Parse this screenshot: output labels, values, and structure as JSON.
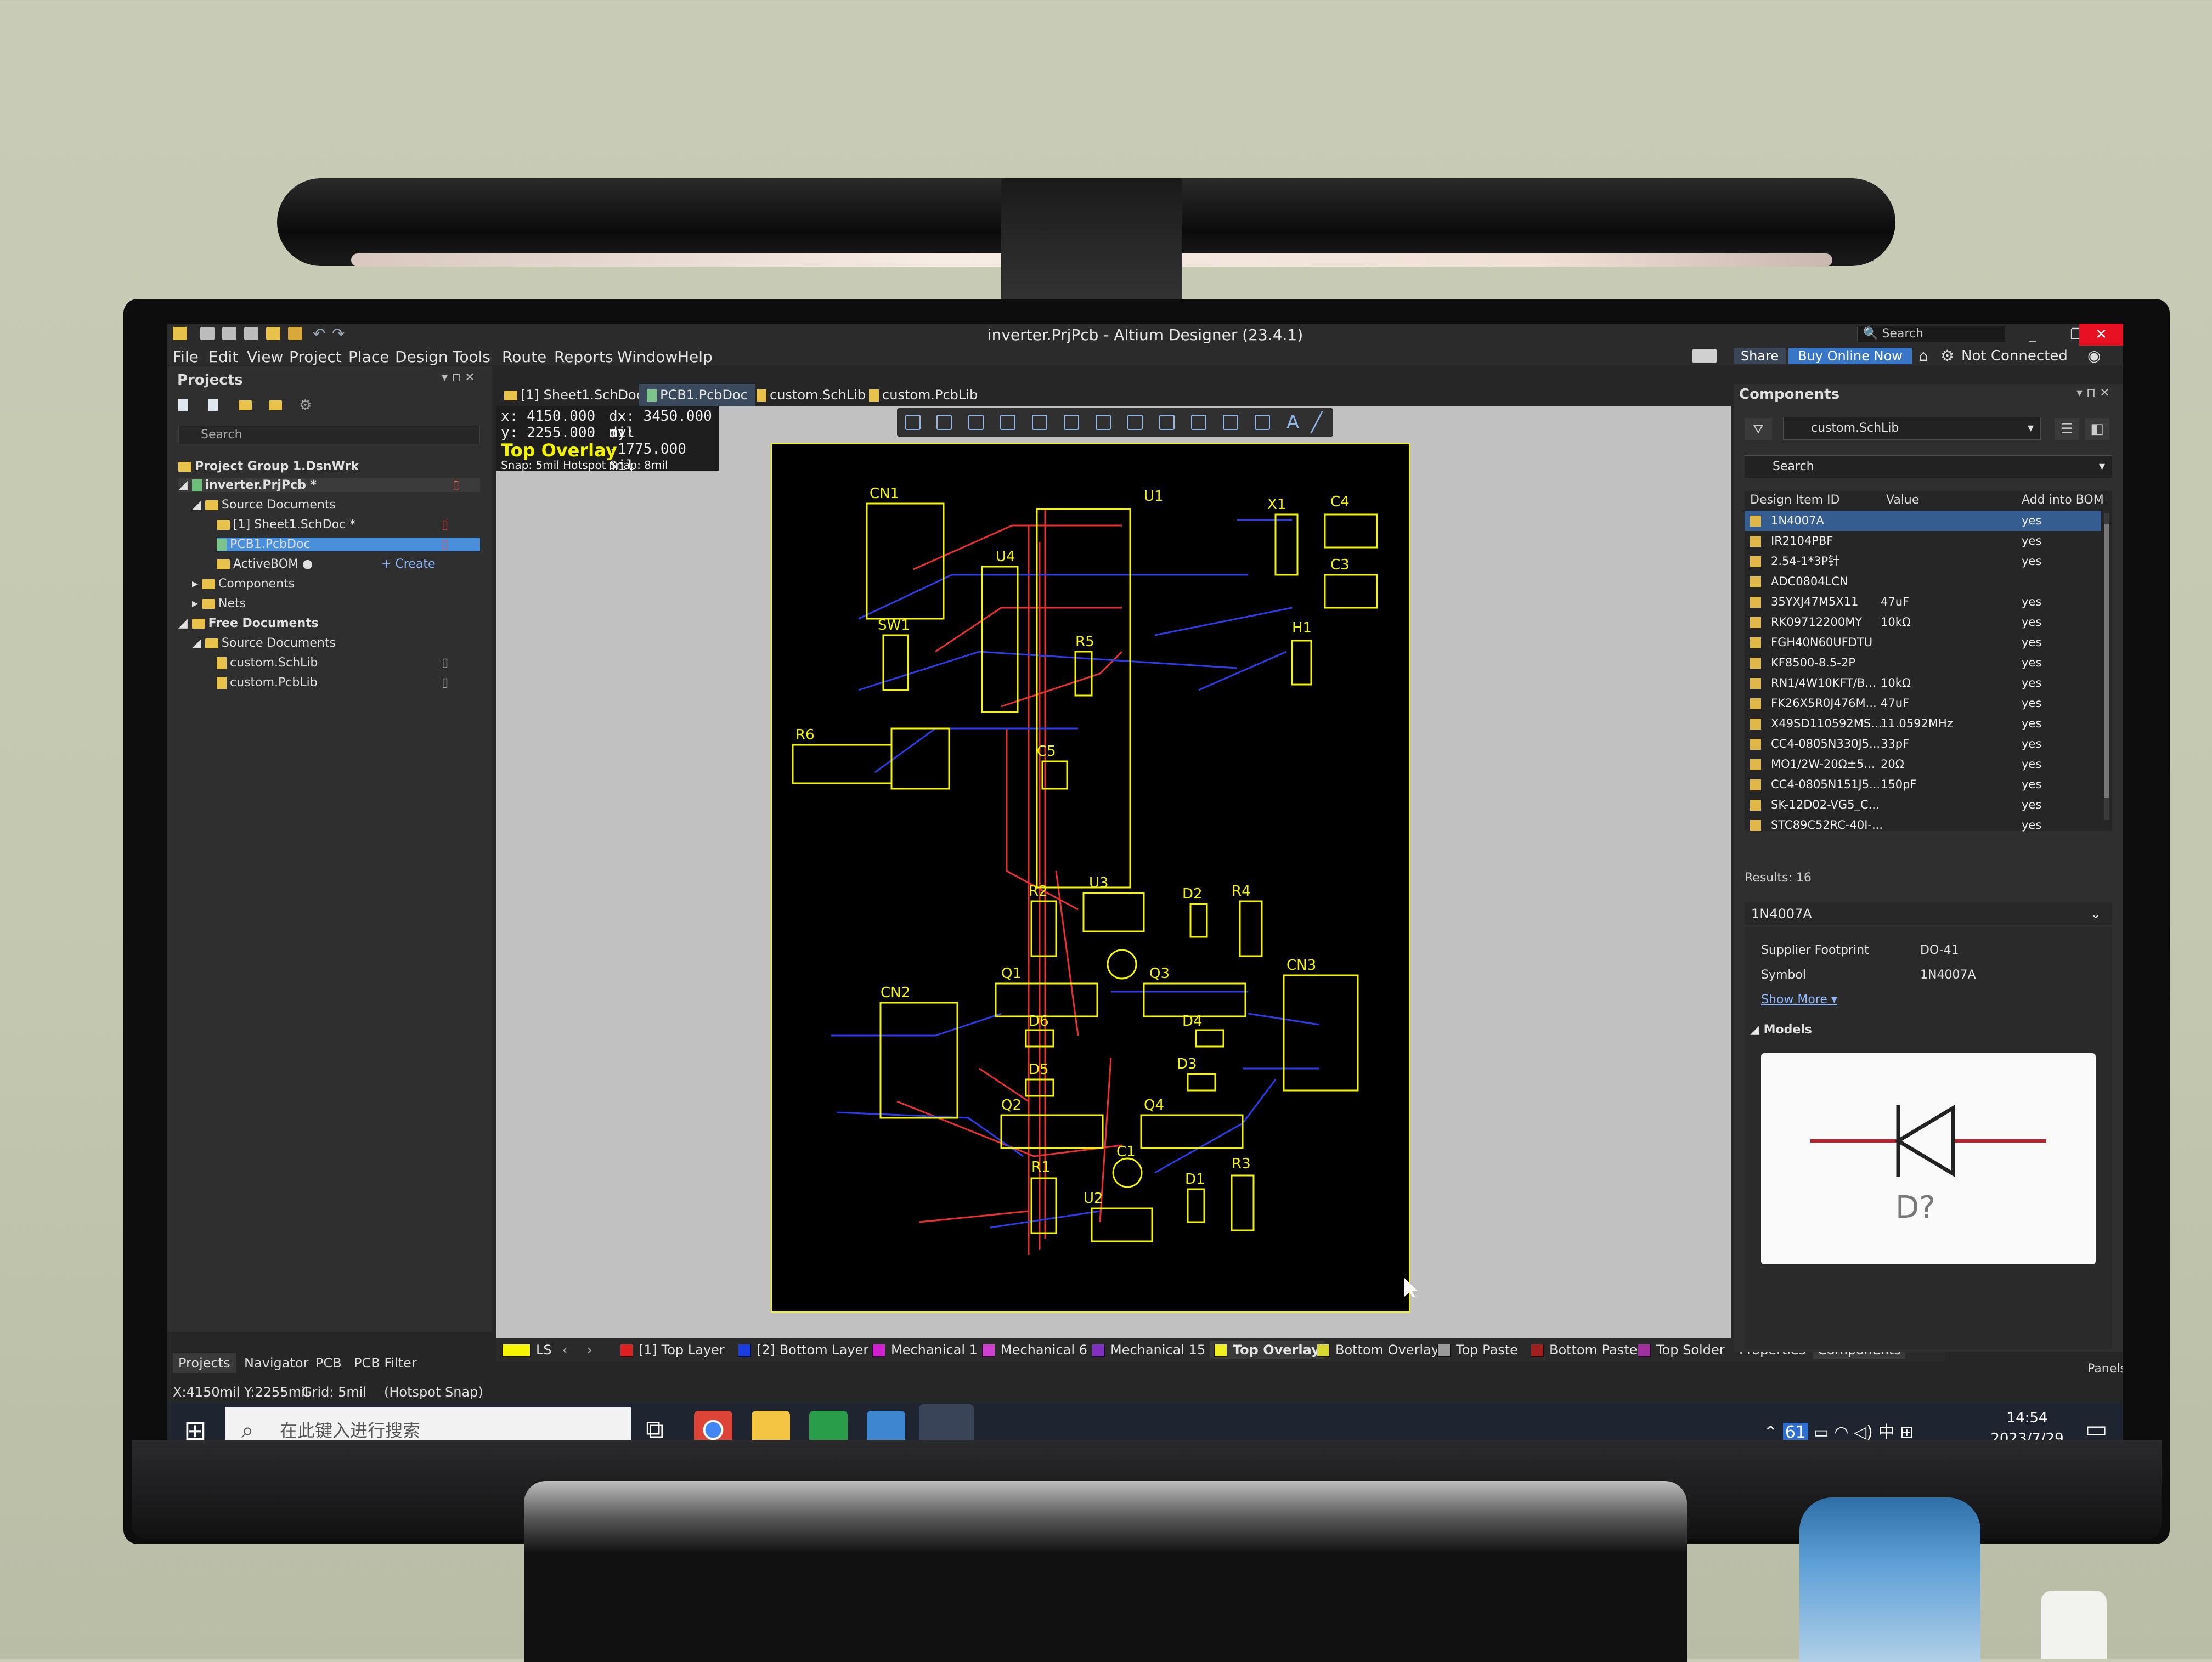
{
  "app": {
    "title": "inverter.PrjPcb - Altium Designer (23.4.1)",
    "search_label": "Search",
    "window_controls": {
      "minimize": "_",
      "restore": "❐",
      "close": "✕"
    }
  },
  "menu": [
    "File",
    "Edit",
    "View",
    "Project",
    "Place",
    "Design",
    "Tools",
    "Route",
    "Reports",
    "Window",
    "Help"
  ],
  "header_actions": {
    "share": "Share",
    "buy": "Buy Online Now",
    "connection": "Not Connected"
  },
  "projects_panel": {
    "title": "Projects",
    "search_placeholder": "Search",
    "tree": {
      "group": "Project Group 1.DsnWrk",
      "project": "inverter.PrjPcb *",
      "source_documents": "Source Documents",
      "sheet": "[1] Sheet1.SchDoc *",
      "pcb": "PCB1.PcbDoc",
      "bom": "ActiveBOM",
      "create": "+ Create",
      "components": "Components",
      "nets": "Nets",
      "free_documents": "Free Documents",
      "free_source": "Source Documents",
      "schlib": "custom.SchLib",
      "pcblib": "custom.PcbLib"
    },
    "bottom_tabs": [
      "Projects",
      "Navigator",
      "PCB",
      "PCB Filter"
    ]
  },
  "document_tabs": [
    "[1] Sheet1.SchDoc *",
    "PCB1.PcbDoc",
    "custom.SchLib",
    "custom.PcbLib"
  ],
  "coords": {
    "x": "x:  4150.000",
    "dx": "dx:  3450.000 mil",
    "y": "y:  2255.000",
    "dy": "dy:  -1775.000 mil",
    "layer": "Top Overlay",
    "snap": "Snap: 5mil Hotspot Snap: 8mil"
  },
  "pcb_labels": {
    "CN1": "CN1",
    "U1": "U1",
    "X1": "X1",
    "C4": "C4",
    "C3": "C3",
    "H1": "H1",
    "U4": "U4",
    "SW1": "SW1",
    "R5": "R5",
    "R6": "R6",
    "C5": "C5",
    "R2": "R2",
    "U3": "U3",
    "D2": "D2",
    "R4": "R4",
    "CN2": "CN2",
    "Q1": "Q1",
    "Q3": "Q3",
    "CN3": "CN3",
    "D6": "D6",
    "D4": "D4",
    "D5": "D5",
    "D3": "D3",
    "Q2": "Q2",
    "Q4": "Q4",
    "C1": "C1",
    "R1": "R1",
    "D1": "D1",
    "R3": "R3",
    "U2": "U2"
  },
  "layer_tabs": {
    "ls": "LS",
    "items": [
      {
        "label": "[1] Top Layer",
        "color": "#e02020"
      },
      {
        "label": "[2] Bottom Layer",
        "color": "#1a3de0"
      },
      {
        "label": "Mechanical 1",
        "color": "#d020d0"
      },
      {
        "label": "Mechanical 6",
        "color": "#d040d0"
      },
      {
        "label": "Mechanical 15",
        "color": "#8030c0"
      },
      {
        "label": "Top Overlay",
        "color": "#f0f020"
      },
      {
        "label": "Bottom Overlay",
        "color": "#d8d830"
      },
      {
        "label": "Top Paste",
        "color": "#9a9a9a"
      },
      {
        "label": "Bottom Paste",
        "color": "#a02020"
      },
      {
        "label": "Top Solder",
        "color": "#a030a0"
      }
    ],
    "right_tabs": [
      "Properties",
      "Components"
    ],
    "panels": "Panels"
  },
  "components_panel": {
    "title": "Components",
    "library": "custom.SchLib",
    "search_placeholder": "Search",
    "columns": [
      "Design Item ID",
      "Value",
      "Add into BOM"
    ],
    "rows": [
      {
        "id": "1N4007A",
        "value": "",
        "bom": "yes"
      },
      {
        "id": "IR2104PBF",
        "value": "",
        "bom": "yes"
      },
      {
        "id": "2.54-1*3P针",
        "value": "",
        "bom": "yes"
      },
      {
        "id": "ADC0804LCN",
        "value": "",
        "bom": ""
      },
      {
        "id": "35YXJ47M5X11",
        "value": "47uF",
        "bom": "yes"
      },
      {
        "id": "RK09712200MY",
        "value": "10kΩ",
        "bom": "yes"
      },
      {
        "id": "FGH40N60UFDTU",
        "value": "",
        "bom": "yes"
      },
      {
        "id": "KF8500-8.5-2P",
        "value": "",
        "bom": "yes"
      },
      {
        "id": "RN1/4W10KFT/B...",
        "value": "10kΩ",
        "bom": "yes"
      },
      {
        "id": "FK26X5R0J476M...",
        "value": "47uF",
        "bom": "yes"
      },
      {
        "id": "X49SD110592MS...",
        "value": "11.0592MHz",
        "bom": "yes"
      },
      {
        "id": "CC4-0805N330J5...",
        "value": "33pF",
        "bom": "yes"
      },
      {
        "id": "MO1/2W-20Ω±5...",
        "value": "20Ω",
        "bom": "yes"
      },
      {
        "id": "CC4-0805N151J5...",
        "value": "150pF",
        "bom": "yes"
      },
      {
        "id": "SK-12D02-VG5_C...",
        "value": "",
        "bom": "yes"
      },
      {
        "id": "STC89C52RC-40I-...",
        "value": "",
        "bom": "yes"
      }
    ],
    "results": "Results: 16",
    "detail": {
      "name": "1N4007A",
      "supplier_footprint_label": "Supplier Footprint",
      "supplier_footprint": "DO-41",
      "symbol_label": "Symbol",
      "symbol": "1N4007A",
      "show_more": "Show More ▾",
      "models": "Models",
      "designator": "D?"
    }
  },
  "status": {
    "position": "X:4150mil Y:2255mil",
    "grid": "Grid: 5mil",
    "snap": "(Hotspot Snap)"
  },
  "taskbar": {
    "search_placeholder": "在此键入进行搜索",
    "tray_number": "61",
    "ime": "中",
    "time": "14:54",
    "date": "2023/7/29"
  }
}
